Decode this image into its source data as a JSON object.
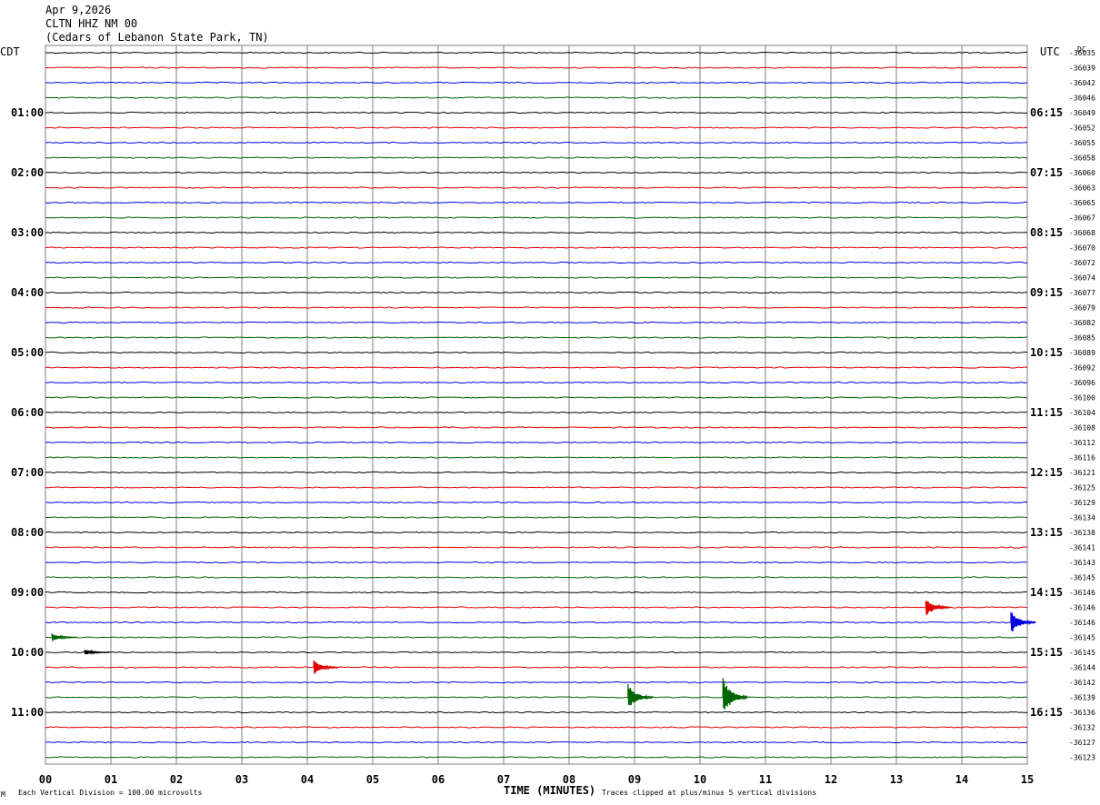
{
  "header": {
    "date": "Apr 9,2026",
    "channel": "CLTN HHZ NM 00",
    "station": "(Cedars of Lebanon State Park, TN)"
  },
  "left_tz": "CDT",
  "right_tz": "UTC",
  "dc_label": "DC",
  "footer": {
    "scale": "Each Vertical Division =  100.00 microvolts",
    "clip": "Traces clipped at plus/minus 5 vertical divisions",
    "mark": "M"
  },
  "colors": {
    "black": "#000000",
    "red": "#e00000",
    "blue": "#0000e0",
    "green": "#006400",
    "grid": "#7f7f7f"
  },
  "chart_data": {
    "type": "helicorder",
    "xlabel": "TIME (MINUTES)",
    "x_ticks": [
      "00",
      "01",
      "02",
      "03",
      "04",
      "05",
      "06",
      "07",
      "08",
      "09",
      "10",
      "11",
      "12",
      "13",
      "14",
      "15"
    ],
    "xlim": [
      0,
      15
    ],
    "trace_colors": [
      "black",
      "red",
      "blue",
      "green"
    ],
    "left_hour_labels": [
      "01:00",
      "02:00",
      "03:00",
      "04:00",
      "05:00",
      "06:00",
      "07:00",
      "08:00",
      "09:00",
      "10:00",
      "11:00"
    ],
    "right_hour_labels": [
      "06:15",
      "07:15",
      "08:15",
      "09:15",
      "10:15",
      "11:15",
      "12:15",
      "13:15",
      "14:15",
      "15:15",
      "16:15"
    ],
    "dc_offsets": [
      "-36035",
      "-36039",
      "-36042",
      "-36046",
      "-36049",
      "-36052",
      "-36055",
      "-36058",
      "-36060",
      "-36063",
      "-36065",
      "-36067",
      "-36068",
      "-36070",
      "-36072",
      "-36074",
      "-36077",
      "-36079",
      "-36082",
      "-36085",
      "-36089",
      "-36092",
      "-36096",
      "-36100",
      "-36104",
      "-36108",
      "-36112",
      "-36116",
      "-36121",
      "-36125",
      "-36129",
      "-36134",
      "-36138",
      "-36141",
      "-36143",
      "-36145",
      "-36146",
      "-36146",
      "-36146",
      "-36145",
      "-36145",
      "-36144",
      "-36142",
      "-36139",
      "-36136",
      "-36132",
      "-36127",
      "-36123"
    ],
    "events": [
      {
        "trace": 37,
        "minute": 13.45,
        "amplitude": 0.6
      },
      {
        "trace": 38,
        "minute": 14.75,
        "amplitude": 0.8
      },
      {
        "trace": 39,
        "minute": 0.1,
        "amplitude": 0.3
      },
      {
        "trace": 40,
        "minute": 0.6,
        "amplitude": 0.2
      },
      {
        "trace": 41,
        "minute": 4.1,
        "amplitude": 0.5
      },
      {
        "trace": 43,
        "minute": 8.9,
        "amplitude": 0.9
      },
      {
        "trace": 43,
        "minute": 10.35,
        "amplitude": 1.3
      }
    ]
  }
}
